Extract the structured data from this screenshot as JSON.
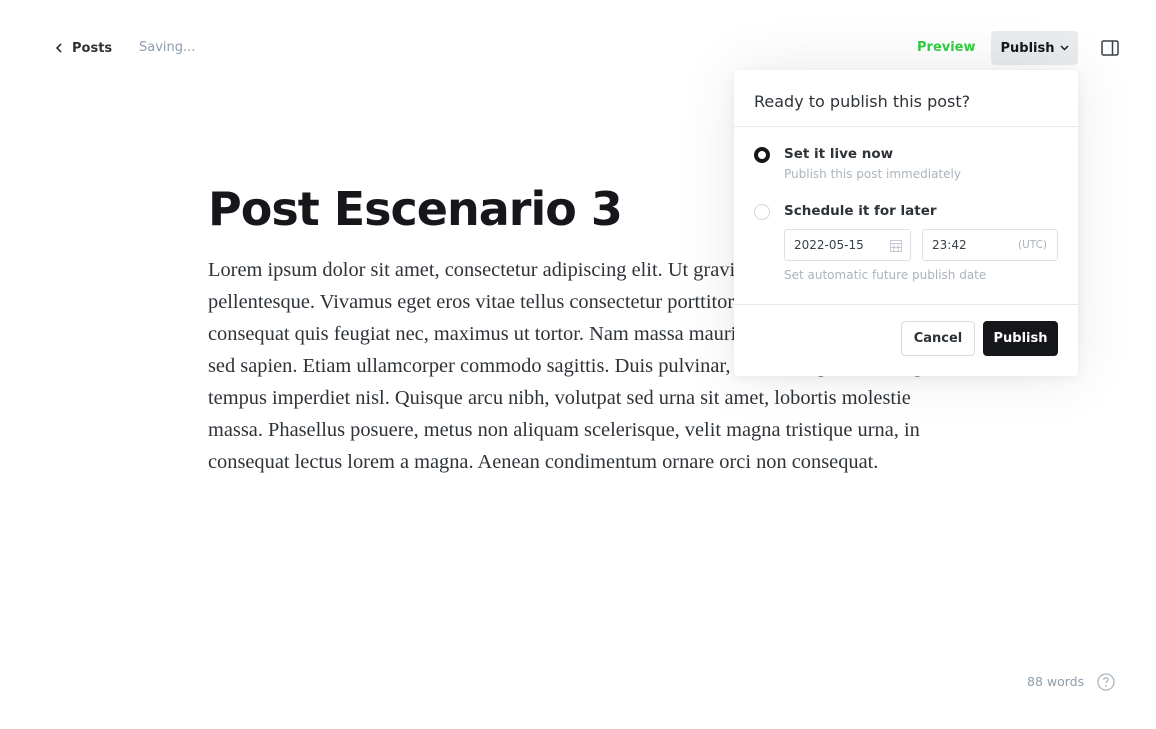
{
  "header": {
    "back_label": "Posts",
    "status": "Saving...",
    "preview_label": "Preview",
    "publish_label": "Publish"
  },
  "post": {
    "title": "Post Escenario 3",
    "body": "Lorem ipsum dolor sit amet, consectetur adipiscing elit. Ut gravida dui nec tortor pellentesque. Vivamus eget eros vitae tellus consectetur porttitor. Sed sem lacus, consequat quis feugiat nec, maximus ut tortor. Nam massa mauris, vestibulum non iaculis sed sapien. Etiam ullamcorper commodo sagittis. Duis pulvinar, sem a tempor libero eget, tempus imperdiet nisl. Quisque arcu nibh, volutpat sed urna sit amet, lobortis molestie massa. Phasellus posuere, metus non aliquam scelerisque, velit magna tristique urna, in consequat lectus lorem a magna. Aenean condimentum ornare orci non consequat."
  },
  "publish_popup": {
    "title": "Ready to publish this post?",
    "options": [
      {
        "label": "Set it live now",
        "description": "Publish this post immediately",
        "selected": true
      },
      {
        "label": "Schedule it for later",
        "description": "",
        "selected": false
      }
    ],
    "date_value": "2022-05-15",
    "time_value": "23:42",
    "timezone": "(UTC)",
    "schedule_hint": "Set automatic future publish date",
    "cancel_label": "Cancel",
    "publish_label": "Publish"
  },
  "footer": {
    "word_count": "88 words"
  },
  "colors": {
    "accent_green": "#30cf43",
    "primary_dark": "#15171a",
    "muted_text": "#8e9cac"
  }
}
